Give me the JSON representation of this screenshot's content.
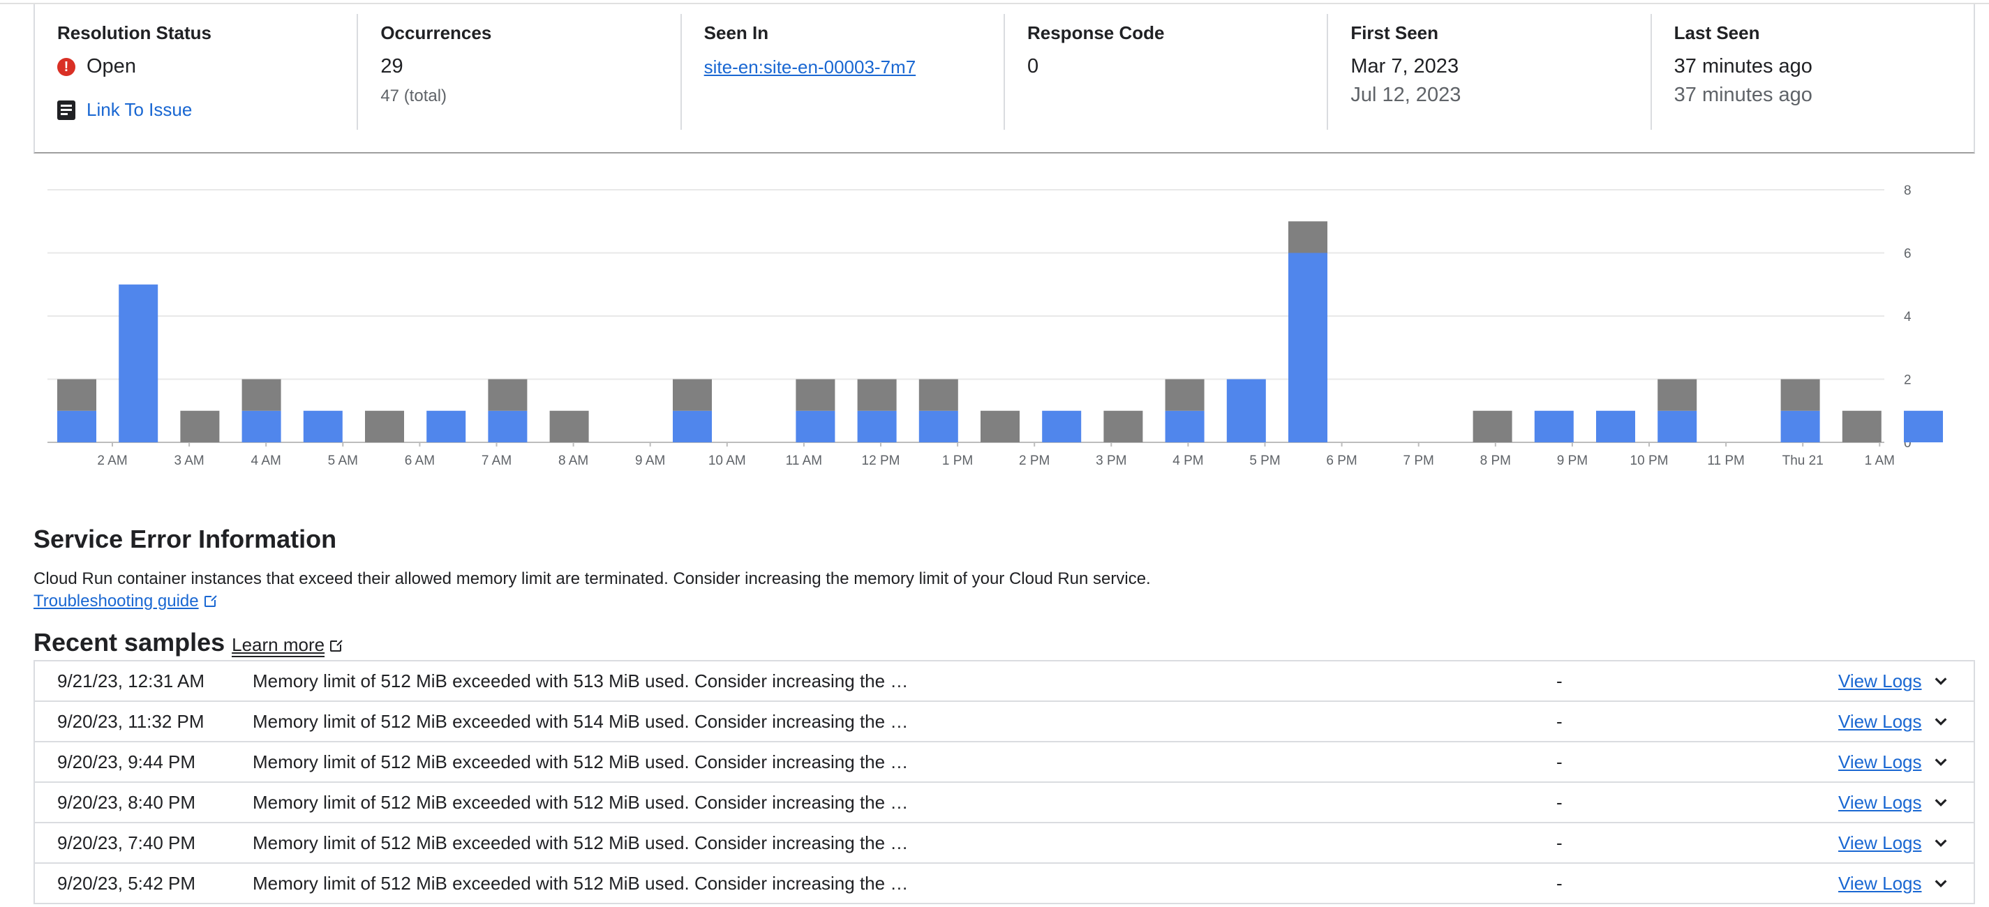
{
  "stats": {
    "resolution": {
      "label": "Resolution Status",
      "value": "Open",
      "link": "Link To Issue"
    },
    "occurrences": {
      "label": "Occurrences",
      "value": "29",
      "total": "47 (total)"
    },
    "seen_in": {
      "label": "Seen In",
      "value": "site-en:site-en-00003-7m7"
    },
    "response_code": {
      "label": "Response Code",
      "value": "0"
    },
    "first_seen": {
      "label": "First Seen",
      "value": "Mar 7, 2023",
      "secondary": "Jul 12, 2023"
    },
    "last_seen": {
      "label": "Last Seen",
      "value": "37 minutes ago",
      "secondary": "37 minutes ago"
    }
  },
  "colors": {
    "blue": "#5086ec",
    "gray": "#808080",
    "link": "#1967d2",
    "error": "#d93025"
  },
  "chart_data": {
    "type": "bar",
    "stacked": true,
    "ylim": [
      0,
      8
    ],
    "yticks": [
      0,
      2,
      4,
      6,
      8
    ],
    "xtick_labels": [
      "2 AM",
      "3 AM",
      "4 AM",
      "5 AM",
      "6 AM",
      "7 AM",
      "8 AM",
      "9 AM",
      "10 AM",
      "11 AM",
      "12 PM",
      "1 PM",
      "2 PM",
      "3 PM",
      "4 PM",
      "5 PM",
      "6 PM",
      "7 PM",
      "8 PM",
      "9 PM",
      "10 PM",
      "11 PM",
      "Thu 21",
      "1 AM"
    ],
    "series": [
      {
        "color": "#5086ec",
        "values": [
          1,
          5,
          0,
          1,
          1,
          0,
          1,
          1,
          0,
          0,
          1,
          0,
          1,
          1,
          1,
          0,
          1,
          0,
          1,
          2,
          6,
          0,
          0,
          0,
          1,
          1,
          1,
          0,
          1,
          0,
          1
        ]
      },
      {
        "color": "#808080",
        "values": [
          1,
          0,
          1,
          1,
          0,
          1,
          0,
          1,
          1,
          0,
          1,
          0,
          1,
          1,
          1,
          1,
          0,
          1,
          1,
          0,
          1,
          0,
          0,
          1,
          0,
          0,
          1,
          0,
          1,
          1,
          0
        ]
      }
    ],
    "grid": true,
    "yaxis_position": "right"
  },
  "service_error": {
    "title": "Service Error Information",
    "description": "Cloud Run container instances that exceed their allowed memory limit are terminated. Consider increasing the memory limit of your Cloud Run service.",
    "guide": "Troubleshooting guide"
  },
  "recent_samples": {
    "title": "Recent samples",
    "learn_more": "Learn more",
    "rows": [
      {
        "time": "9/21/23, 12:31 AM",
        "message": "Memory limit of 512 MiB exceeded with 513 MiB used. Consider increasing the …",
        "col3": "-",
        "action": "View Logs"
      },
      {
        "time": "9/20/23, 11:32 PM",
        "message": "Memory limit of 512 MiB exceeded with 514 MiB used. Consider increasing the …",
        "col3": "-",
        "action": "View Logs"
      },
      {
        "time": "9/20/23, 9:44 PM",
        "message": "Memory limit of 512 MiB exceeded with 512 MiB used. Consider increasing the …",
        "col3": "-",
        "action": "View Logs"
      },
      {
        "time": "9/20/23, 8:40 PM",
        "message": "Memory limit of 512 MiB exceeded with 512 MiB used. Consider increasing the …",
        "col3": "-",
        "action": "View Logs"
      },
      {
        "time": "9/20/23, 7:40 PM",
        "message": "Memory limit of 512 MiB exceeded with 512 MiB used. Consider increasing the …",
        "col3": "-",
        "action": "View Logs"
      },
      {
        "time": "9/20/23, 5:42 PM",
        "message": "Memory limit of 512 MiB exceeded with 512 MiB used. Consider increasing the …",
        "col3": "-",
        "action": "View Logs"
      }
    ]
  }
}
